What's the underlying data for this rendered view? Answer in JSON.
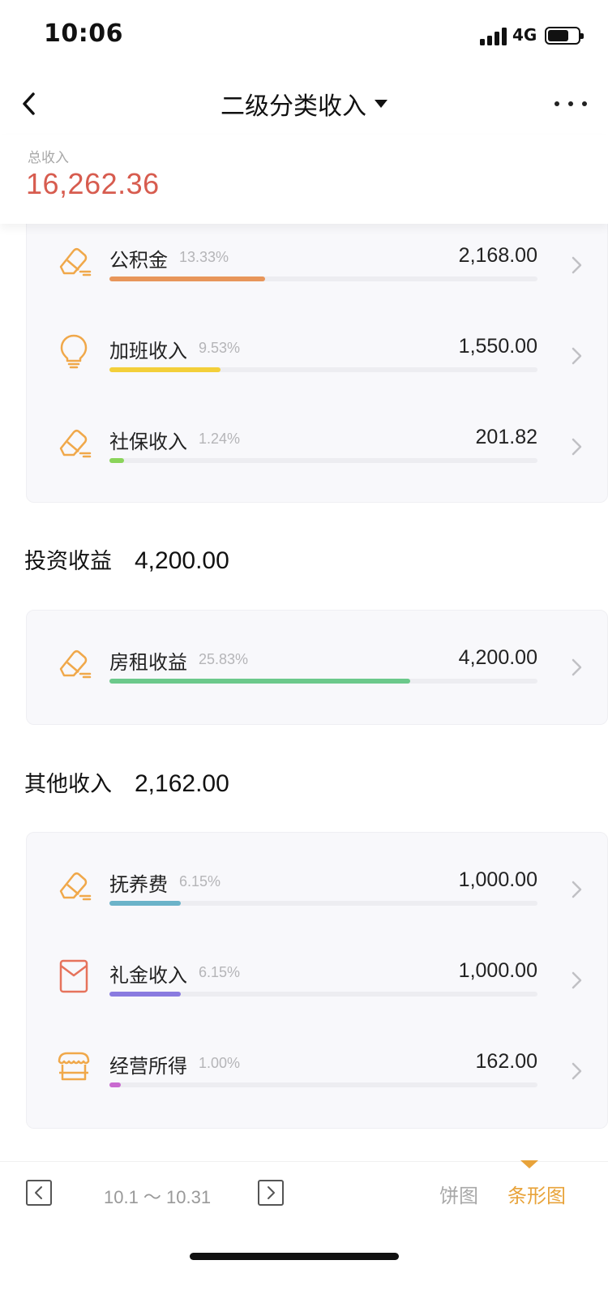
{
  "status_bar": {
    "time": "10:06",
    "network": "4G"
  },
  "nav": {
    "title": "二级分类收入"
  },
  "summary": {
    "label": "总收入",
    "value": "16,262.36",
    "value_color": "#d75c4f"
  },
  "groups": [
    {
      "items": [
        {
          "name": "公积金",
          "percent_label": "13.33%",
          "amount": "2,168.00",
          "bar_fraction": 0.3629,
          "bar_color": "#e8965a",
          "icon": "pencil-eraser-icon"
        },
        {
          "name": "加班收入",
          "percent_label": "9.53%",
          "amount": "1,550.00",
          "bar_fraction": 0.2595,
          "bar_color": "#f3cf3a",
          "icon": "lightbulb-icon"
        },
        {
          "name": "社保收入",
          "percent_label": "1.24%",
          "amount": "201.82",
          "bar_fraction": 0.0338,
          "bar_color": "#8ad45a",
          "icon": "pencil-eraser-icon"
        }
      ]
    },
    {
      "name": "投资收益",
      "amount": "4,200.00",
      "items": [
        {
          "name": "房租收益",
          "percent_label": "25.83%",
          "amount": "4,200.00",
          "bar_fraction": 0.7031,
          "bar_color": "#6cc98b",
          "icon": "pencil-eraser-icon"
        }
      ]
    },
    {
      "name": "其他收入",
      "amount": "2,162.00",
      "items": [
        {
          "name": "抚养费",
          "percent_label": "6.15%",
          "amount": "1,000.00",
          "bar_fraction": 0.1674,
          "bar_color": "#6bb3c9",
          "icon": "pencil-eraser-icon"
        },
        {
          "name": "礼金收入",
          "percent_label": "6.15%",
          "amount": "1,000.00",
          "bar_fraction": 0.1674,
          "bar_color": "#8a7be0",
          "icon": "red-envelope-icon"
        },
        {
          "name": "经营所得",
          "percent_label": "1.00%",
          "amount": "162.00",
          "bar_fraction": 0.0271,
          "bar_color": "#c96ad0",
          "icon": "shop-awning-icon"
        }
      ]
    }
  ],
  "bottom_bar": {
    "date_range": "10.1 ～ 10.31",
    "tab_pie": "饼图",
    "tab_bar": "条形图",
    "active_tab": "条形图",
    "accent_color": "#e8a33a"
  }
}
